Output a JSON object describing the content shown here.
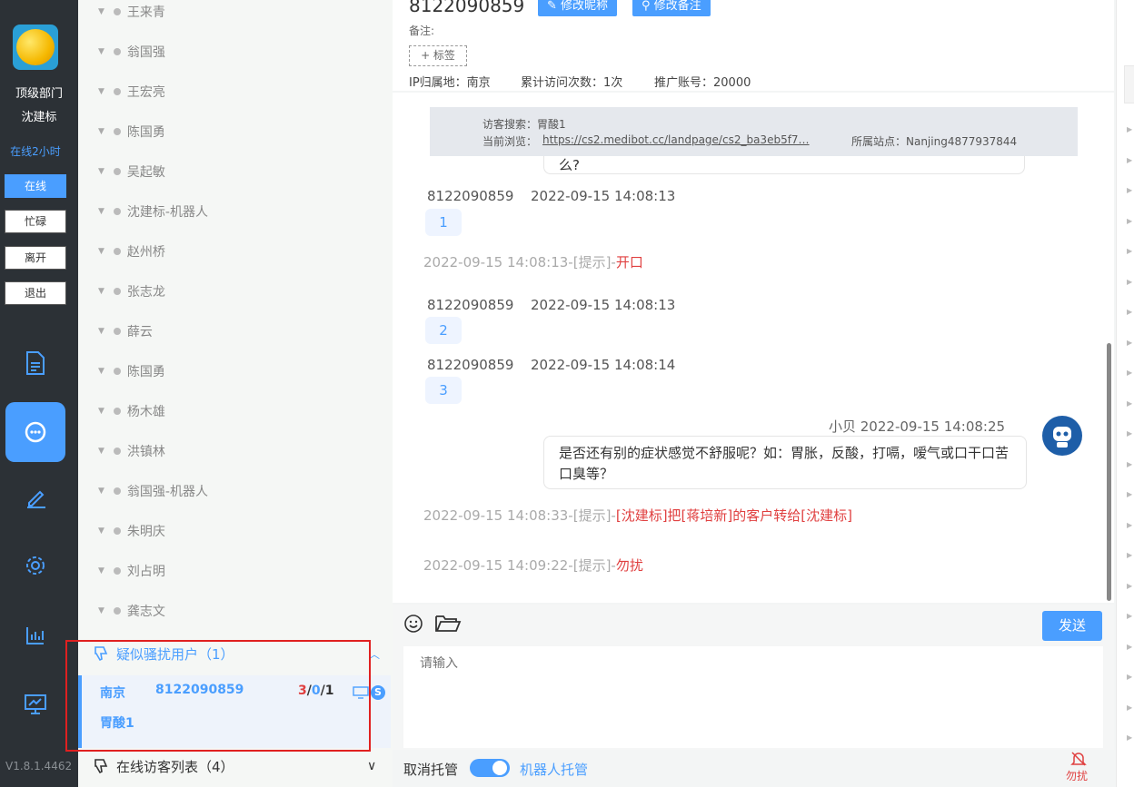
{
  "sidebar": {
    "department": "顶级部门",
    "username": "沈建标",
    "online_time": "在线2小时",
    "status_buttons": [
      "在线",
      "忙碌",
      "离开",
      "退出"
    ],
    "version": "V1.8.1.4462",
    "nav_icons": [
      "document-icon",
      "chat-icon",
      "edit-icon",
      "gear-icon",
      "chart-icon",
      "monitor-icon"
    ]
  },
  "visitor_list": {
    "items": [
      "王来青",
      "翁国强",
      "王宏亮",
      "陈国勇",
      "吴起敏",
      "沈建标-机器人",
      "赵州桥",
      "张志龙",
      "薛云",
      "陈国勇",
      "杨木雄",
      "洪镇林",
      "翁国强-机器人",
      "朱明庆",
      "刘占明",
      "龚志文"
    ],
    "harass_group": "疑似骚扰用户（1）",
    "selected": {
      "city": "南京",
      "id": "8122090859",
      "count_red": "3",
      "count_blue": "0",
      "count_dark": "1",
      "keyword": "胃酸1",
      "sep": "/"
    },
    "online_group": "在线访客列表（4）"
  },
  "header": {
    "visitor_id": "8122090859",
    "edit_nick": "修改昵称",
    "edit_note": "修改备注",
    "note_label": "备注:",
    "tag_button": "+ 标签",
    "ip_location": "IP归属地：南京",
    "visit_count": "累计访问次数：1次",
    "promo_account": "推广账号：20000"
  },
  "info_banner": {
    "search": "访客搜索：胃酸1",
    "browse_label": "当前浏览：",
    "browse_url": "https://cs2.medibot.cc/landpage/cs2_ba3eb5f7…",
    "site": "所属站点：Nanjing4877937844"
  },
  "chat": {
    "partial_bubble": "么?",
    "messages": [
      {
        "sender": "8122090859",
        "time": "2022-09-15 14:08:13",
        "text": "1"
      },
      {
        "sender": "8122090859",
        "time": "2022-09-15 14:08:13",
        "text": "2"
      },
      {
        "sender": "8122090859",
        "time": "2022-09-15 14:08:14",
        "text": "3"
      }
    ],
    "tips": [
      {
        "prefix": "2022-09-15 14:08:13-[提示]-",
        "red": "开口"
      },
      {
        "prefix": "2022-09-15 14:08:33-[提示]-",
        "red": "[沈建标]把[蒋培新]的客户转给[沈建标]"
      },
      {
        "prefix": "2022-09-15 14:09:22-[提示]-",
        "red": "勿扰"
      }
    ],
    "agent_msg": {
      "meta": "小贝 2022-09-15 14:08:25",
      "text": "是否还有别的症状感觉不舒服呢？如：胃胀，反酸，打嗝，嗳气或口干口苦口臭等？"
    }
  },
  "input": {
    "placeholder": "请输入",
    "send": "发送"
  },
  "bottom": {
    "cancel_hosting": "取消托管",
    "robot_hosting": "机器人托管",
    "dnd": "勿扰"
  },
  "colors": {
    "accent": "#4a9eff",
    "sidebar_bg": "#2c3136",
    "warn": "#e04040"
  }
}
